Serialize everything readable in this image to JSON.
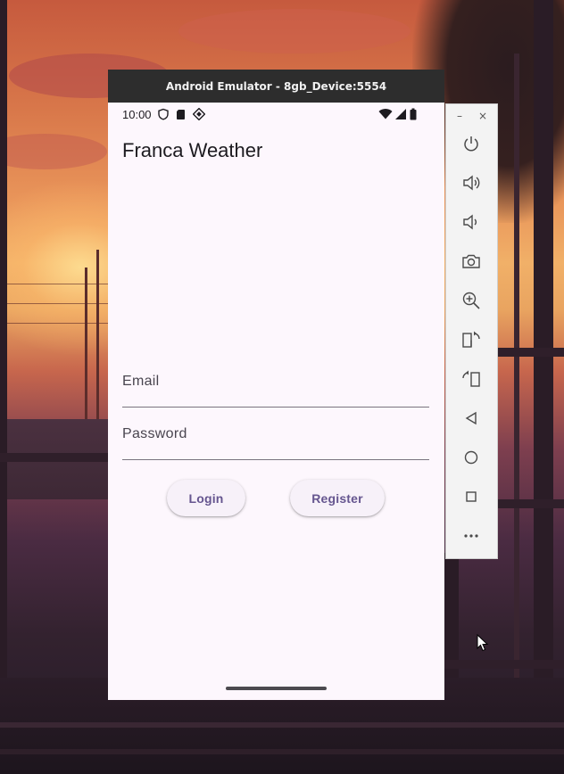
{
  "window": {
    "title": "Android Emulator - 8gb_Device:5554"
  },
  "status_bar": {
    "time": "10:00",
    "left_icons": [
      "shield-icon",
      "sd-card-icon",
      "debug-icon"
    ],
    "right_icons": [
      "wifi-icon",
      "signal-icon",
      "battery-icon"
    ]
  },
  "app": {
    "title": "Franca Weather",
    "email_label": "Email",
    "email_value": "",
    "password_label": "Password",
    "password_value": "",
    "login_label": "Login",
    "register_label": "Register"
  },
  "emulator_toolbar": {
    "minimize": "–",
    "close": "×",
    "tools": [
      "power-icon",
      "volume-up-icon",
      "volume-down-icon",
      "camera-icon",
      "zoom-in-icon",
      "rotate-left-icon",
      "rotate-right-icon",
      "back-icon",
      "home-icon",
      "overview-icon",
      "more-icon"
    ]
  },
  "colors": {
    "accent": "#65558f",
    "surface": "#fdf7fd",
    "titlebar": "#2d2d2d"
  }
}
